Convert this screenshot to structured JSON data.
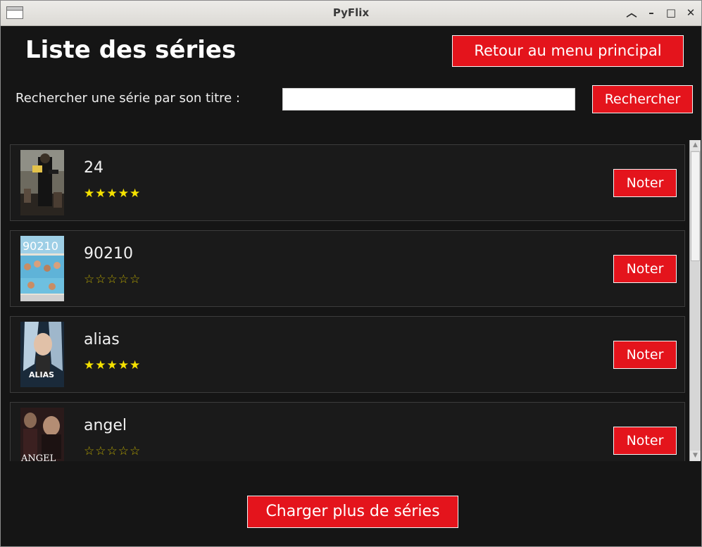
{
  "window": {
    "title": "PyFlix"
  },
  "header": {
    "title": "Liste des séries",
    "back_button": "Retour au menu principal"
  },
  "search": {
    "label": "Rechercher une série par son titre :",
    "value": "",
    "button": "Rechercher"
  },
  "series": [
    {
      "title": "24",
      "rating": 5,
      "stars": "★★★★★",
      "rate_button": "Noter",
      "poster": "24-poster"
    },
    {
      "title": "90210",
      "rating": 0,
      "stars": "☆☆☆☆☆",
      "rate_button": "Noter",
      "poster": "90210-poster"
    },
    {
      "title": "alias",
      "rating": 5,
      "stars": "★★★★★",
      "rate_button": "Noter",
      "poster": "alias-poster"
    },
    {
      "title": "angel",
      "rating": 0,
      "stars": "☆☆☆☆☆",
      "rate_button": "Noter",
      "poster": "angel-poster"
    }
  ],
  "footer": {
    "load_more_button": "Charger plus de séries"
  },
  "colors": {
    "background": "#151515",
    "accent": "#e4141c",
    "star": "#f5e200"
  }
}
